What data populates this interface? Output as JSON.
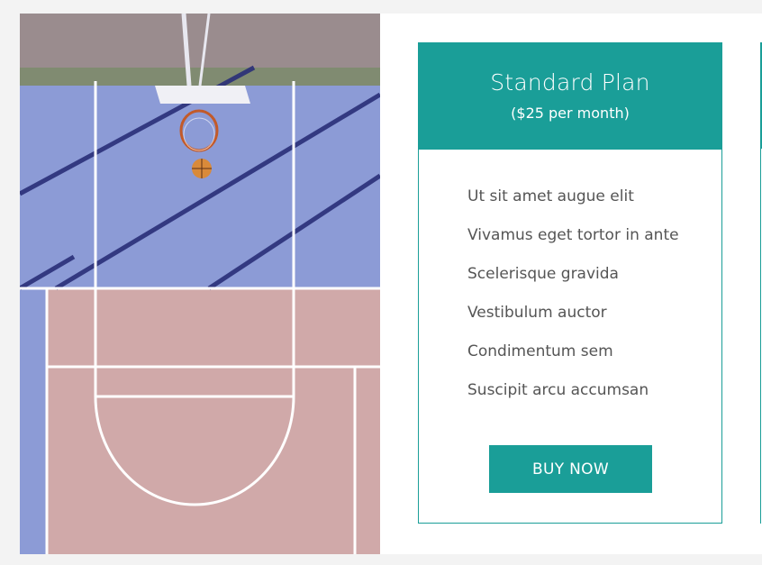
{
  "image": {
    "alt": ""
  },
  "plan": {
    "name": "Standard Plan",
    "price": "($25 per month)",
    "features": [
      "Ut sit amet augue elit",
      "Vivamus eget tortor in ante",
      "Scelerisque gravida",
      "Vestibulum auctor",
      "Condimentum sem",
      "Suscipit arcu accumsan"
    ],
    "buy_label": "BUY NOW"
  },
  "colors": {
    "accent": "#1a9e98",
    "court_blue": "#8c9bd6",
    "court_pink": "#d0a9a9"
  }
}
